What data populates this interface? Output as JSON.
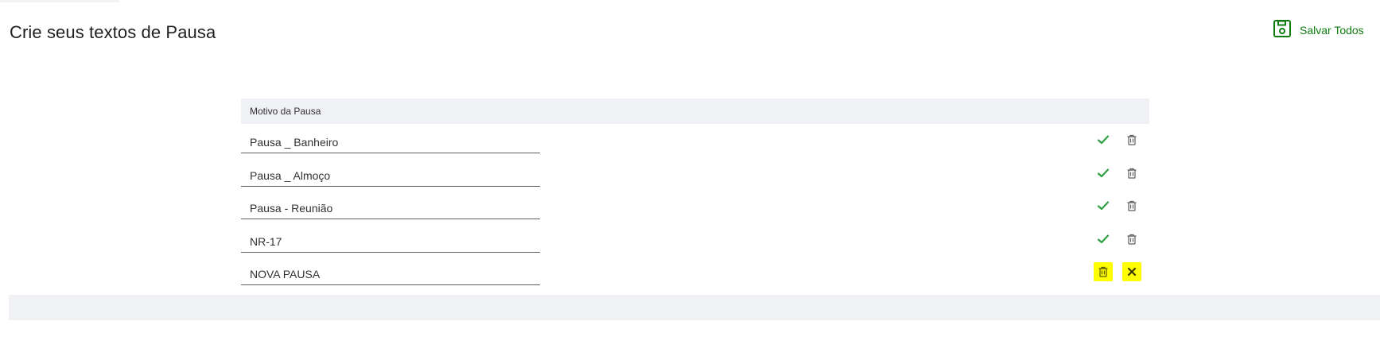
{
  "page": {
    "title": "Crie seus textos de Pausa"
  },
  "toolbar": {
    "save_all_label": "Salvar Todos",
    "save_icon": "save-icon"
  },
  "table": {
    "header": "Motivo da Pausa",
    "rows": [
      {
        "value": "Pausa _ Banheiro",
        "actions": [
          "check-icon",
          "trash-icon"
        ]
      },
      {
        "value": "Pausa _ Almoço",
        "actions": [
          "check-icon",
          "trash-icon"
        ]
      },
      {
        "value": "Pausa - Reunião",
        "actions": [
          "check-icon",
          "trash-icon"
        ]
      },
      {
        "value": "NR-17",
        "actions": [
          "check-icon",
          "trash-icon"
        ]
      },
      {
        "value": "NOVA PAUSA",
        "actions": [
          "trash-icon",
          "close-icon"
        ],
        "highlighted": true
      }
    ]
  },
  "colors": {
    "accent_green": "#107c10",
    "check_green": "#2ea043",
    "icon_gray": "#605e5c",
    "highlight_yellow": "#ffff00",
    "header_bg": "#f0f1f5"
  }
}
